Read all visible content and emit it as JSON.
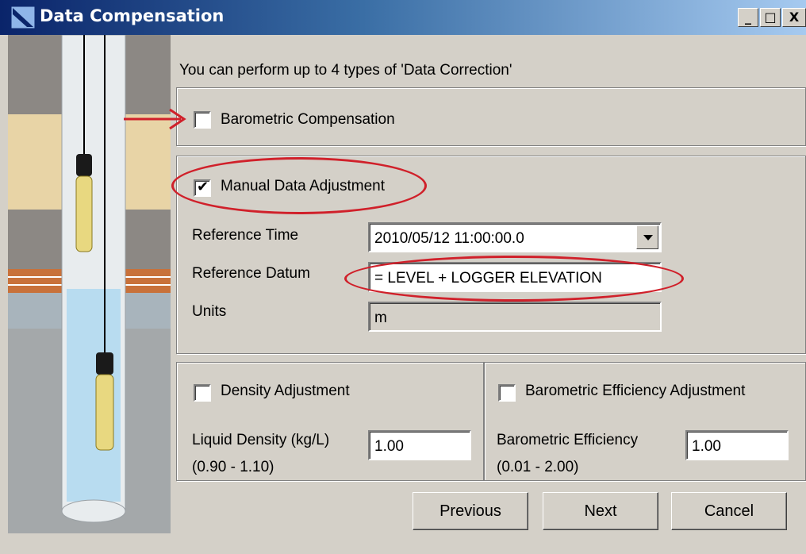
{
  "window": {
    "title": "Data Compensation",
    "min_label": "_",
    "max_label": "□",
    "close_label": "X"
  },
  "intro": "You can perform up to 4 types of 'Data Correction'",
  "barometric": {
    "label": "Barometric Compensation",
    "checked": false
  },
  "manual": {
    "label": "Manual Data Adjustment",
    "checked": true,
    "reference_time_label": "Reference Time",
    "reference_time_value": "2010/05/12 11:00:00.0",
    "reference_datum_label": "Reference Datum",
    "reference_datum_value": "= LEVEL + LOGGER ELEVATION",
    "units_label": "Units",
    "units_value": "m"
  },
  "density": {
    "label": "Density Adjustment",
    "checked": false,
    "field_label": "Liquid Density (kg/L)",
    "range": "(0.90 - 1.10)",
    "value": "1.00"
  },
  "baro_eff": {
    "label": "Barometric Efficiency Adjustment",
    "checked": false,
    "field_label": "Barometric Efficiency",
    "range": "(0.01 - 2.00)",
    "value": "1.00"
  },
  "buttons": {
    "previous": "Previous",
    "next": "Next",
    "cancel": "Cancel"
  },
  "colors": {
    "annotation": "#d0202a",
    "title_start": "#0a246a",
    "title_end": "#a6caf0",
    "dialog_bg": "#d4d0c8"
  },
  "icons": {
    "app": "data-compensation-app-icon",
    "check": "checkmark-icon",
    "dropdown": "chevron-down-icon"
  }
}
